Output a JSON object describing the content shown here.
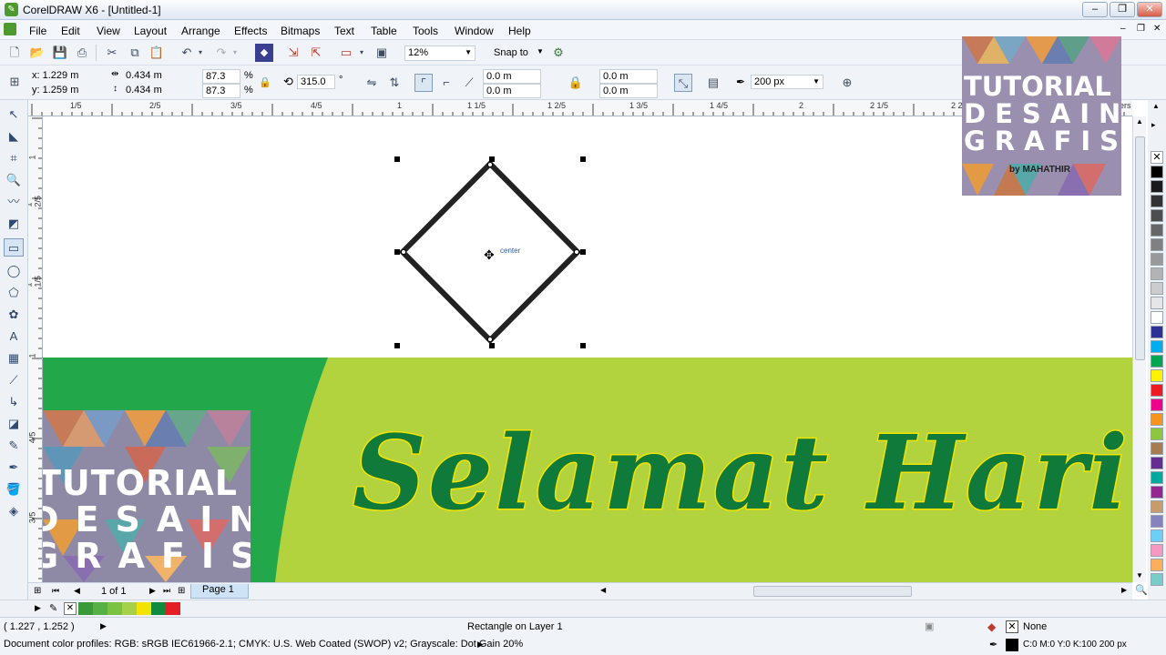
{
  "app": {
    "title": "CorelDRAW X6 - [Untitled-1]"
  },
  "menu": [
    "File",
    "Edit",
    "View",
    "Layout",
    "Arrange",
    "Effects",
    "Bitmaps",
    "Text",
    "Table",
    "Tools",
    "Window",
    "Help"
  ],
  "toolbar": {
    "zoom": "12%",
    "snap_label": "Snap to"
  },
  "propbar": {
    "x": "x: 1.229 m",
    "y": "y: 1.259 m",
    "w": "0.434 m",
    "h": "0.434 m",
    "sx": "87.3",
    "sy": "87.3",
    "pct": "%",
    "angle": "315.0",
    "deg": "°",
    "c1": "0.0 m",
    "c2": "0.0 m",
    "c3": "0.0 m",
    "c4": "0.0 m",
    "outline": "200 px"
  },
  "ruler": {
    "h": [
      "1/5",
      "2/5",
      "3/5",
      "4/5",
      "1",
      "1 1/5",
      "1 2/5",
      "1 3/5",
      "1 4/5",
      "2",
      "2 1/5",
      "2 2/5"
    ],
    "v": [
      "1",
      "1 2/5",
      "1 1/5",
      "1",
      "4/5",
      "3/5"
    ],
    "unit": "meters"
  },
  "canvas": {
    "center_label": "center",
    "banner_text": "Selamat Hari R",
    "logo_big": {
      "line1": "TUTORIAL",
      "line2": "DESAIN",
      "line3": "GRAFIS",
      "by": "by MAHATHIR"
    },
    "logo_small": {
      "line1": "TUTORIAL",
      "line2": "DESAIN",
      "line3": "GRAFIS"
    }
  },
  "pagebar": {
    "pages": "1 of 1",
    "tab": "Page 1"
  },
  "status": {
    "coords": "( 1.227 , 1.252 )",
    "object": "Rectangle on Layer 1",
    "profiles": "Document color profiles: RGB: sRGB IEC61966-2.1; CMYK: U.S. Web Coated (SWOP) v2; Grayscale: Dot Gain 20%",
    "fill": "None",
    "outline": "C:0 M:0 Y:0 K:100  200 px"
  },
  "colors": {
    "accent": "#2f5aa8",
    "banner_green": "#b2d23e",
    "dark_green": "#0f7a3a",
    "text_yellow": "#f5e400",
    "palette": [
      "#ffffff",
      "#000000",
      "#1a1a1a",
      "#333333",
      "#4d4d4d",
      "#666666",
      "#808080",
      "#999999",
      "#b3b3b3",
      "#cccccc",
      "#e6e6e6",
      "#ffffff",
      "#2e3192",
      "#00aeef",
      "#00a651",
      "#fff200",
      "#ed1c24",
      "#ec008c",
      "#f7941d",
      "#8dc63f",
      "#a67c52",
      "#662d91",
      "#00a99d",
      "#92278f",
      "#c69c6d",
      "#8781bd",
      "#6dcff6",
      "#f49ac1",
      "#fbaf5d",
      "#7accc8"
    ],
    "docswatches": [
      "#3a9a3a",
      "#55b046",
      "#7cc242",
      "#a6d048",
      "#f3e400",
      "#108a3e",
      "#e31e24"
    ]
  }
}
